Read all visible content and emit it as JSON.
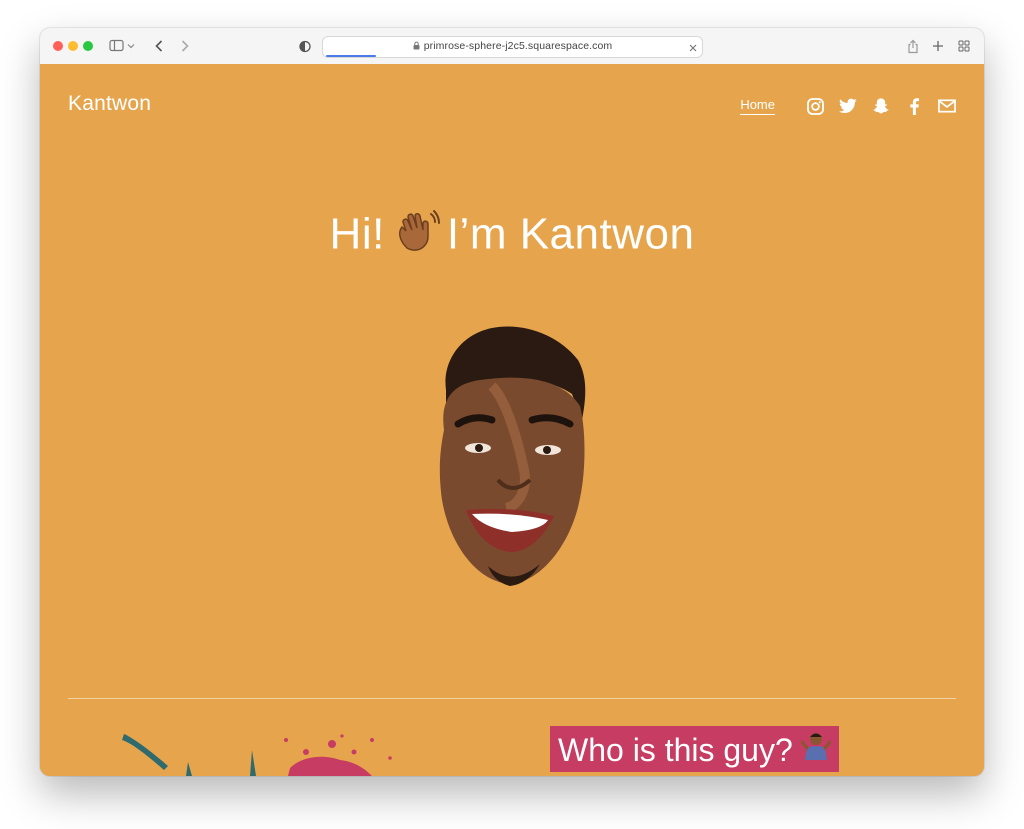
{
  "browser": {
    "url": "primrose-sphere-j2c5.squarespace.com",
    "traffic_lights": [
      "#ff5f57",
      "#febc2e",
      "#28c840"
    ]
  },
  "site": {
    "brand": "Kantwon",
    "nav": {
      "home": "Home"
    },
    "social_icons": [
      "instagram-icon",
      "twitter-icon",
      "snapchat-icon",
      "facebook-icon",
      "mail-icon"
    ]
  },
  "hero": {
    "greeting": "Hi!",
    "name_line": "I’m Kantwon"
  },
  "section": {
    "heading": "Who is this guy?"
  },
  "colors": {
    "page_background": "#e6a54d",
    "heading_highlight": "#c73c62",
    "text": "#ffffff"
  }
}
